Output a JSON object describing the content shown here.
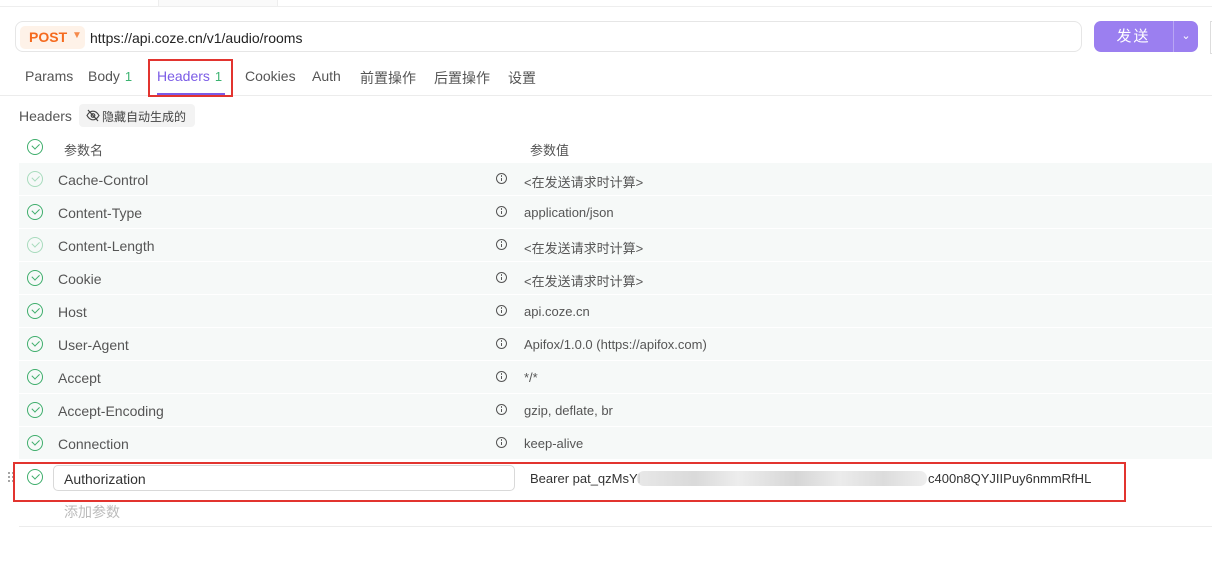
{
  "request": {
    "method": "POST",
    "url": "https://api.coze.cn/v1/audio/rooms",
    "send_label": "发送"
  },
  "tabs": [
    {
      "label": "Params",
      "count": ""
    },
    {
      "label": "Body",
      "count": "1"
    },
    {
      "label": "Headers",
      "count": "1",
      "active": true
    },
    {
      "label": "Cookies",
      "count": ""
    },
    {
      "label": "Auth",
      "count": ""
    },
    {
      "label": "前置操作",
      "count": ""
    },
    {
      "label": "后置操作",
      "count": ""
    },
    {
      "label": "设置",
      "count": ""
    }
  ],
  "headers_section": {
    "label": "Headers",
    "hide_button": "隐藏自动生成的",
    "col_name": "参数名",
    "col_value": "参数值",
    "rows": [
      {
        "name": "Cache-Control",
        "value": "<在发送请求时计算>"
      },
      {
        "name": "Content-Type",
        "value": "application/json"
      },
      {
        "name": "Content-Length",
        "value": "<在发送请求时计算>"
      },
      {
        "name": "Cookie",
        "value": "<在发送请求时计算>"
      },
      {
        "name": "Host",
        "value": "api.coze.cn"
      },
      {
        "name": "User-Agent",
        "value": "Apifox/1.0.0 (https://apifox.com)"
      },
      {
        "name": "Accept",
        "value": "*/*"
      },
      {
        "name": "Accept-Encoding",
        "value": "gzip, deflate, br"
      },
      {
        "name": "Connection",
        "value": "keep-alive"
      }
    ],
    "custom_row": {
      "name": "Authorization",
      "value_visible_start": "Bearer pat_qzMsYl",
      "value_visible_end": "c400n8QYJIIPuy6nmmRfHL"
    },
    "add_placeholder": "添加参数"
  },
  "colors": {
    "accent": "#7b5ce6",
    "send_button": "#9b7ff0",
    "method": "#f56a1e",
    "check": "#3fae6c",
    "highlight": "#e2342f"
  }
}
